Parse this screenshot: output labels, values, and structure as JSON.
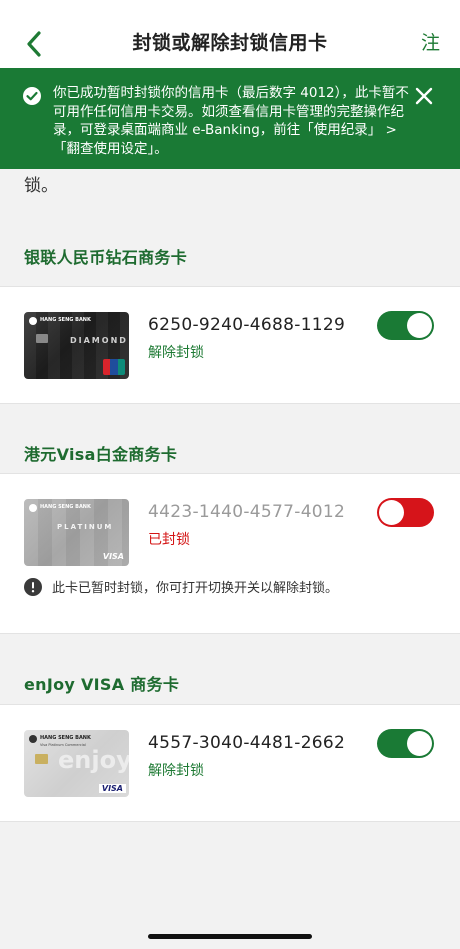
{
  "header": {
    "title": "封锁或解除封锁信用卡",
    "right_label": "注"
  },
  "toast": {
    "message": "你已成功暂时封锁你的信用卡（最后数字 4012），此卡暂不可用作任何信用卡交易。如须查看信用卡管理的完整操作纪录，可登录桌面端商业 e-Banking，前往「使用纪录」 > 「翻查使用设定」。"
  },
  "partial_text": "锁。",
  "sections": [
    {
      "title": "银联人民币钻石商务卡",
      "card": {
        "number": "6250-9240-4688-1129",
        "status": "解除封锁",
        "toggle_on": true,
        "bank_label": "HANG SENG BANK",
        "type_label": "DIAMOND",
        "brand_label": "UnionPay 银联"
      }
    },
    {
      "title": "港元Visa白金商务卡",
      "card": {
        "number": "4423-1440-4577-4012",
        "status": "已封锁",
        "toggle_on": false,
        "bank_label": "HANG SENG BANK",
        "type_label": "PLATINUM",
        "brand_label": "VISA"
      },
      "warning": "此卡已暂时封锁，你可打开切换开关以解除封锁。"
    },
    {
      "title": "enJoy VISA 商务卡",
      "card": {
        "number": "4557-3040-4481-2662",
        "status": "解除封锁",
        "toggle_on": true,
        "bank_label": "HANG SENG BANK",
        "sub_label": "Visa Platinum Commercial",
        "type_label": "enjoy",
        "brand_label": "VISA"
      }
    }
  ],
  "colors": {
    "brand_green": "#1a7a35",
    "locked_red": "#d6141a"
  }
}
